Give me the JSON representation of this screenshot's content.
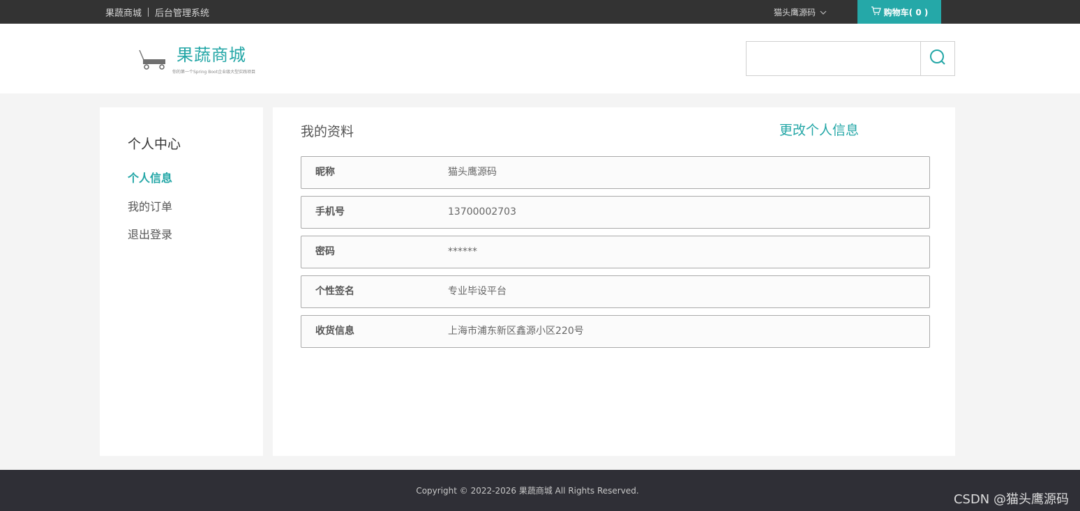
{
  "topbar": {
    "site_link": "果蔬商城",
    "admin_link": "后台管理系统",
    "username": "猫头鹰源码",
    "cart_label": "购物车( 0 )",
    "cart_icon": "cart-icon",
    "accent_color": "#25a8a8"
  },
  "header": {
    "logo_title": "果蔬商城",
    "logo_subtitle": "你的第一个Spring Boot企业级大型实践项目",
    "logo_icon": "cart-wagon-icon",
    "search_placeholder": "",
    "search_value": "",
    "search_icon": "search-icon"
  },
  "sidebar": {
    "title": "个人中心",
    "items": [
      {
        "label": "个人信息",
        "active": true
      },
      {
        "label": "我的订单",
        "active": false
      },
      {
        "label": "退出登录",
        "active": false
      }
    ]
  },
  "main": {
    "title": "我的资料",
    "edit_link": "更改个人信息",
    "rows": [
      {
        "label": "昵称",
        "value": "猫头鹰源码"
      },
      {
        "label": "手机号",
        "value": "13700002703"
      },
      {
        "label": "密码",
        "value": "******"
      },
      {
        "label": "个性签名",
        "value": "专业毕设平台"
      },
      {
        "label": "收货信息",
        "value": "上海市浦东新区鑫源小区220号"
      }
    ]
  },
  "footer": {
    "copyright": "Copyright © 2022-2026 果蔬商城 All Rights Reserved."
  },
  "watermark": "CSDN @猫头鹰源码"
}
